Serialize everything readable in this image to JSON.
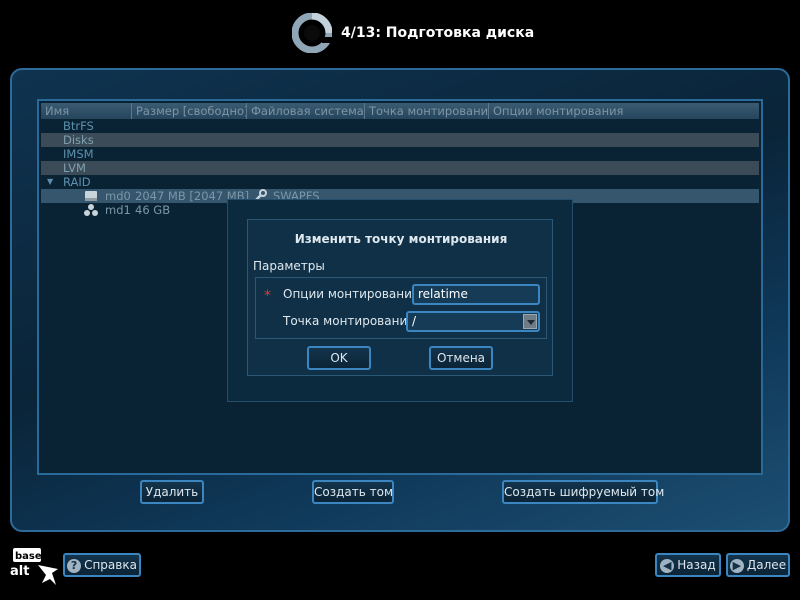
{
  "header": {
    "step_title": "4/13: Подготовка диска"
  },
  "table": {
    "columns": [
      "Имя",
      "Размер [свободно]",
      "Файловая система",
      "Точка монтирования",
      "Опции монтирования"
    ],
    "rows": [
      {
        "label": "BtrFS"
      },
      {
        "label": "Disks"
      },
      {
        "label": "IMSM"
      },
      {
        "label": "LVM"
      },
      {
        "label": "RAID"
      }
    ],
    "raid_children": [
      {
        "name": "md0",
        "size": "2047 MB [2047 MB]",
        "fs": "SWAPFS",
        "icon": "drive-icon"
      },
      {
        "name": "md1",
        "size": "46 GB",
        "fs": "",
        "icon": "volume-group-icon"
      }
    ]
  },
  "buttons": {
    "delete": "Удалить",
    "create_volume": "Создать том",
    "create_encrypted": "Создать шифруемый том"
  },
  "dialog": {
    "title": "Изменить точку монтирования",
    "group_label": "Параметры",
    "required_mark": "*",
    "options_label": "Опции монтирования",
    "options_value": "relatime",
    "mount_label": "Точка монтирования",
    "mount_value": "/",
    "ok": "OK",
    "cancel": "Отмена"
  },
  "footer": {
    "logo_text_top": "base",
    "logo_text_bottom": "alt",
    "help": "Справка",
    "back": "Назад",
    "next": "Далее"
  },
  "colors": {
    "accent": "#3b86c0",
    "required": "#e03a2f",
    "background": "#0a2334"
  }
}
